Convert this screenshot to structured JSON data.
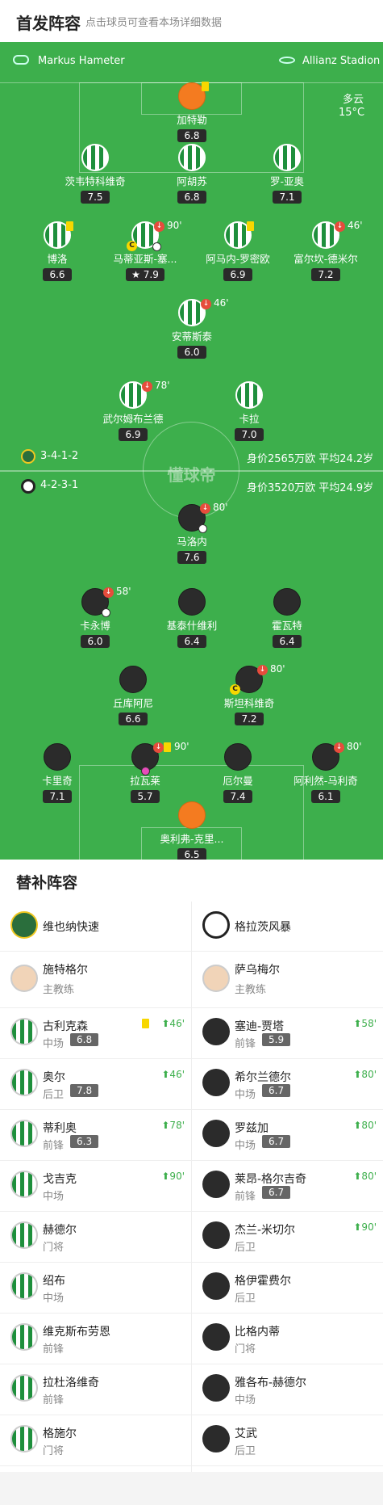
{
  "header": {
    "title": "首发阵容",
    "subtitle": "点击球员可查看本场详细数据"
  },
  "pitch": {
    "home_coach": "Markus Hameter",
    "venue": "Allianz Stadion",
    "weather": "多云",
    "temp": "15°C",
    "home_form": "3-4-1-2",
    "home_val": "身价2565万欧 平均24.2岁",
    "away_form": "4-2-3-1",
    "away_val": "身价3520万欧 平均24.9岁",
    "watermark": "懂球帝"
  },
  "home_players": [
    {
      "name": "加特勒",
      "rating": "6.8",
      "kit": "gk",
      "ycard": true
    },
    {
      "name": "茨韦特科维奇",
      "rating": "7.5",
      "kit": "home"
    },
    {
      "name": "阿胡苏",
      "rating": "6.8",
      "kit": "home"
    },
    {
      "name": "罗-亚奥",
      "rating": "7.1",
      "kit": "home"
    },
    {
      "name": "博洛",
      "rating": "6.6",
      "kit": "home",
      "ycard": true
    },
    {
      "name": "马蒂亚斯-塞...",
      "rating": "7.9",
      "kit": "home",
      "sub": "90'",
      "cap": true,
      "ball": true,
      "star": true
    },
    {
      "name": "阿马内-罗密欧",
      "rating": "6.9",
      "kit": "home",
      "ycard": true
    },
    {
      "name": "富尔坎-德米尔",
      "rating": "7.2",
      "kit": "home",
      "sub": "46'"
    },
    {
      "name": "安蒂斯泰",
      "rating": "6.0",
      "kit": "home",
      "sub": "46'"
    },
    {
      "name": "武尔姆布兰德",
      "rating": "6.9",
      "kit": "home",
      "sub": "78'"
    },
    {
      "name": "卡拉",
      "rating": "7.0",
      "kit": "home"
    }
  ],
  "away_players": [
    {
      "name": "马洛内",
      "rating": "7.6",
      "kit": "away",
      "sub": "80'",
      "ball": true
    },
    {
      "name": "卡永博",
      "rating": "6.0",
      "kit": "away",
      "sub": "58'",
      "ball": true
    },
    {
      "name": "基泰什维利",
      "rating": "6.4",
      "kit": "away"
    },
    {
      "name": "霍瓦特",
      "rating": "6.4",
      "kit": "away"
    },
    {
      "name": "丘库阿尼",
      "rating": "6.6",
      "kit": "away"
    },
    {
      "name": "斯坦科维奇",
      "rating": "7.2",
      "kit": "away",
      "sub": "80'",
      "cap": true
    },
    {
      "name": "卡里奇",
      "rating": "7.1",
      "kit": "away"
    },
    {
      "name": "拉瓦莱",
      "rating": "5.7",
      "kit": "away",
      "sub": "90'",
      "ycard": true,
      "pinkball": true
    },
    {
      "name": "厄尔曼",
      "rating": "7.4",
      "kit": "away"
    },
    {
      "name": "阿利然-马利奇",
      "rating": "6.1",
      "kit": "away",
      "sub": "80'"
    },
    {
      "name": "奥利弗-克里...",
      "rating": "6.5",
      "kit": "gk"
    }
  ],
  "subs": {
    "title": "替补阵容",
    "home_team": "维也纳快速",
    "away_team": "格拉茨风暴",
    "home_coach": {
      "name": "施特格尔",
      "role": "主教练"
    },
    "away_coach": {
      "name": "萨乌梅尔",
      "role": "主教练"
    },
    "home": [
      {
        "name": "古利克森",
        "pos": "中场",
        "rating": "6.8",
        "min": "46'",
        "ycard": true
      },
      {
        "name": "奥尔",
        "pos": "后卫",
        "rating": "7.8",
        "min": "46'"
      },
      {
        "name": "蒂利奥",
        "pos": "前锋",
        "rating": "6.3",
        "min": "78'"
      },
      {
        "name": "戈吉克",
        "pos": "中场",
        "rating": "",
        "min": "90'"
      },
      {
        "name": "赫德尔",
        "pos": "门将",
        "rating": "",
        "min": ""
      },
      {
        "name": "绍布",
        "pos": "中场",
        "rating": "",
        "min": ""
      },
      {
        "name": "维克斯布劳恩",
        "pos": "前锋",
        "rating": "",
        "min": ""
      },
      {
        "name": "拉杜洛维奇",
        "pos": "前锋",
        "rating": "",
        "min": ""
      },
      {
        "name": "格施尔",
        "pos": "门将",
        "rating": "",
        "min": ""
      }
    ],
    "away": [
      {
        "name": "塞迪-贾塔",
        "pos": "前锋",
        "rating": "5.9",
        "min": "58'"
      },
      {
        "name": "希尔兰德尔",
        "pos": "中场",
        "rating": "6.7",
        "min": "80'"
      },
      {
        "name": "罗兹加",
        "pos": "中场",
        "rating": "6.7",
        "min": "80'"
      },
      {
        "name": "莱昂-格尔吉奇",
        "pos": "前锋",
        "rating": "6.7",
        "min": "80'"
      },
      {
        "name": "杰兰-米切尔",
        "pos": "后卫",
        "rating": "",
        "min": "90'"
      },
      {
        "name": "格伊霍费尔",
        "pos": "后卫",
        "rating": "",
        "min": ""
      },
      {
        "name": "比格内蒂",
        "pos": "门将",
        "rating": "",
        "min": ""
      },
      {
        "name": "雅各布-赫德尔",
        "pos": "中场",
        "rating": "",
        "min": ""
      },
      {
        "name": "艾武",
        "pos": "后卫",
        "rating": "",
        "min": ""
      }
    ]
  }
}
